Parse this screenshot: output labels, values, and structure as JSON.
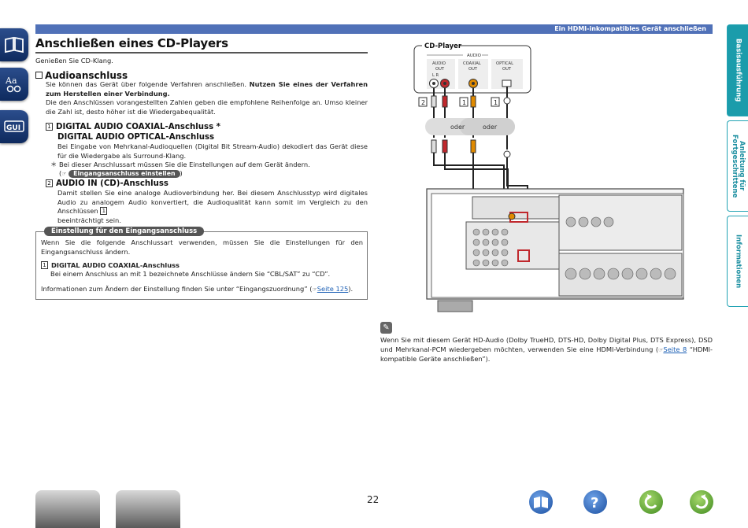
{
  "header": {
    "section_label": "Ein HDMI-inkompatibles Gerät anschließen"
  },
  "page": {
    "title": "Anschließen eines CD-Players",
    "number": "22"
  },
  "intro": "Genießen Sie CD-Klang.",
  "audio_section": {
    "heading": "Audioanschluss",
    "text_part1": "Sie können das Gerät über folgende Verfahren anschließen. ",
    "text_bold": "Nutzen Sie eines der Verfahren zum Herstellen einer Verbindung.",
    "text2": "Die den Anschlüssen vorangestellten Zahlen geben die empfohlene Reihenfolge an. Umso kleiner die Zahl ist, desto höher ist die Wiedergabequalität."
  },
  "method1": {
    "num": "1",
    "heading_line1": "DIGITAL AUDIO COAXIAL-Anschluss *",
    "heading_line2": "DIGITAL AUDIO OPTICAL-Anschluss",
    "desc": "Bei Eingabe von Mehrkanal-Audioquellen (Digital Bit Stream-Audio) dekodiert das Gerät diese für die Wiedergabe als Surround-Klang.",
    "note_marker": "＊",
    "note": "Bei dieser Anschlussart müssen Sie die Einstellungen auf dem Gerät ändern.",
    "ref_pill": "Eingangsanschluss einstellen"
  },
  "method2": {
    "num": "2",
    "heading": "AUDIO IN (CD)-Anschluss",
    "desc": "Damit stellen Sie eine analoge Audioverbindung her. Bei diesem Anschlusstyp wird digitales Audio zu analogem Audio konvertiert, die Audioqualität kann somit im Vergleich zu den Anschlüssen",
    "desc_num": "1",
    "desc_end": "beeinträchtigt sein."
  },
  "settings_box": {
    "label": "Einstellung für den Eingangsanschluss",
    "text": "Wenn Sie die folgende Anschlussart verwenden, müssen Sie die Einstellungen für den Eingangsanschluss ändern.",
    "item_num": "1",
    "item_heading": "DIGITAL AUDIO COAXIAL-Anschluss",
    "item_text": "Bei einem Anschluss an mit 1 bezeichnete Anschlüsse ändern Sie “CBL/SAT” zu “CD”.",
    "footer_text": "Informationen zum Ändern der Einstellung finden Sie unter “Eingangszuordnung” (",
    "footer_link": "Seite 125",
    "footer_end": ")."
  },
  "diagram": {
    "cd_player_label": "CD-Player",
    "audio_group": "AUDIO",
    "audio_out": "AUDIO\nOUT",
    "lr": "L    R",
    "coaxial_out": "COAXIAL\nOUT",
    "optical_out": "OPTICAL\nOUT",
    "num2": "2",
    "num1a": "1",
    "num1b": "1",
    "oder1": "oder",
    "oder2": "oder"
  },
  "bottom_note": {
    "text": "Wenn Sie mit diesem Gerät HD-Audio (Dolby TrueHD, DTS-HD, Dolby Digital Plus, DTS Express), DSD und Mehrkanal-PCM wiedergeben möchten, verwenden Sie eine HDMI-Verbindung (",
    "link": "Seite 8",
    "end": " “HDMI-kompatible Geräte anschließen”)."
  },
  "right_tabs": [
    "Basisausführung",
    "Anleitung für Fortgeschrittene",
    "Informationen"
  ],
  "left_icons": [
    "book-icon",
    "text-icon",
    "gui-icon"
  ],
  "colors": {
    "accent": "#5071b8",
    "tab": "#1b9cab"
  }
}
